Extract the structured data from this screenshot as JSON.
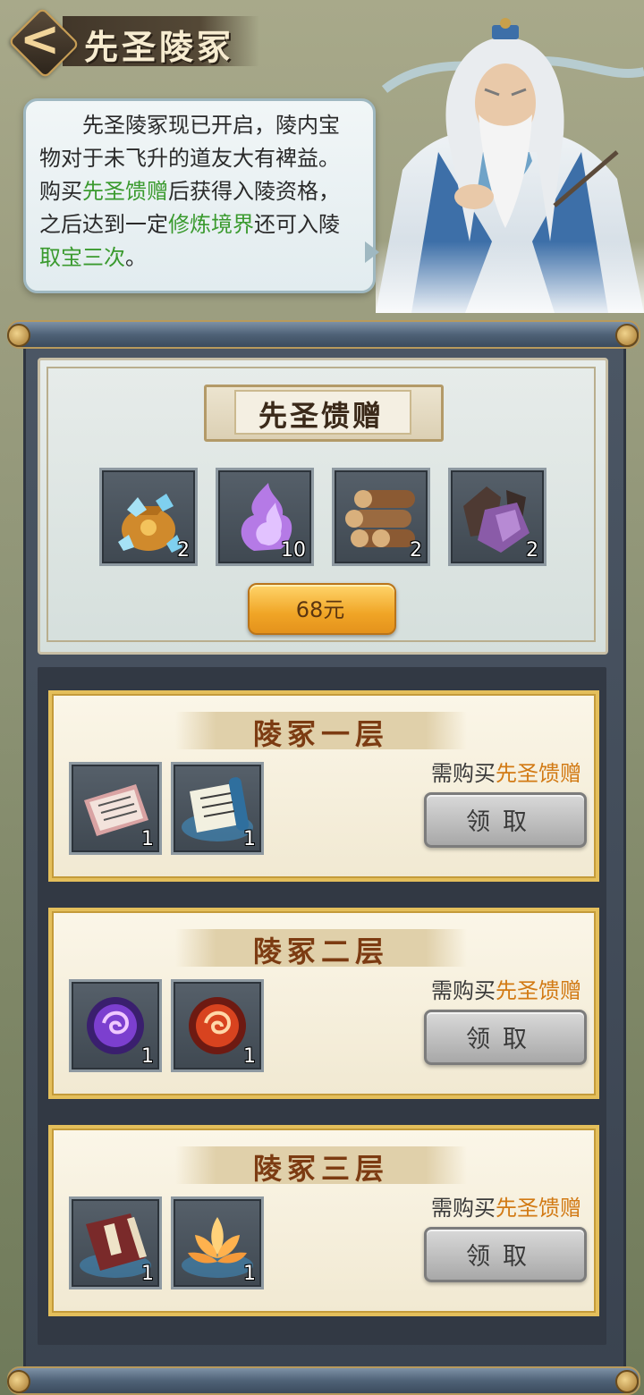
{
  "header": {
    "title": "先圣陵冢",
    "back_label": "<"
  },
  "intro": {
    "segments": [
      {
        "text": "先圣陵冢现已开启，陵内宝物对于未飞升的道友大有裨益。购买",
        "highlight": false
      },
      {
        "text": "先圣馈赠",
        "highlight": true
      },
      {
        "text": "后获得入陵资格，之后达到一定",
        "highlight": false
      },
      {
        "text": "修炼境界",
        "highlight": true
      },
      {
        "text": "还可入陵",
        "highlight": false
      },
      {
        "text": "取宝三次",
        "highlight": true
      },
      {
        "text": "。",
        "highlight": false
      }
    ]
  },
  "gift": {
    "title": "先圣馈赠",
    "price": "68元",
    "items": [
      {
        "icon": "spirit-stone-bag-icon",
        "count": "2"
      },
      {
        "icon": "purple-flame-icon",
        "count": "10"
      },
      {
        "icon": "wood-logs-icon",
        "count": "2"
      },
      {
        "icon": "dark-crystal-ore-icon",
        "count": "2"
      }
    ]
  },
  "floors": [
    {
      "title": "陵冢一层",
      "requirement_prefix": "需购买",
      "requirement_item": "先圣馈赠",
      "claim_label": "领取",
      "items": [
        {
          "icon": "letter-scroll-icon",
          "count": "1"
        },
        {
          "icon": "skill-scroll-icon",
          "count": "1"
        }
      ]
    },
    {
      "title": "陵冢二层",
      "requirement_prefix": "需购买",
      "requirement_item": "先圣馈赠",
      "claim_label": "领取",
      "items": [
        {
          "icon": "purple-orb-icon",
          "count": "1"
        },
        {
          "icon": "red-orb-icon",
          "count": "1"
        }
      ]
    },
    {
      "title": "陵冢三层",
      "requirement_prefix": "需购买",
      "requirement_item": "先圣馈赠",
      "claim_label": "领取",
      "items": [
        {
          "icon": "book-icon",
          "count": "1"
        },
        {
          "icon": "golden-lotus-icon",
          "count": "1"
        }
      ]
    }
  ],
  "colors": {
    "highlight_green": "#3a9a2e",
    "highlight_orange": "#d27a14",
    "floor_title": "#7c3b12",
    "card_border": "#e4bf5b"
  }
}
